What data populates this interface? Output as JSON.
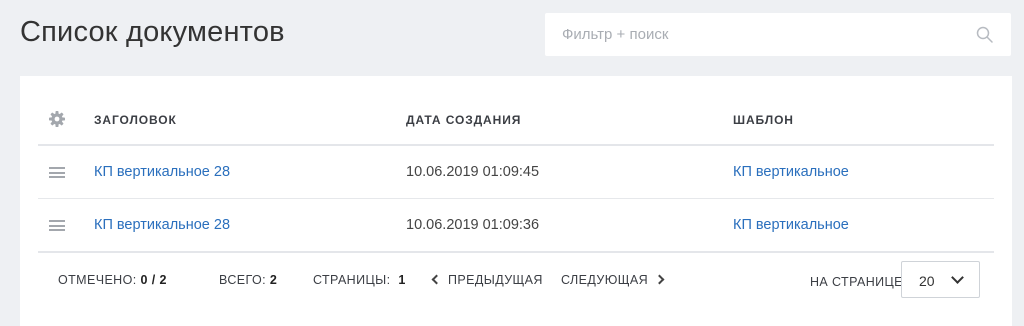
{
  "header": {
    "title": "Список документов",
    "search": {
      "placeholder": "Фильтр + поиск",
      "value": ""
    }
  },
  "table": {
    "columns": [
      "ЗАГОЛОВОК",
      "ДАТА СОЗДАНИЯ",
      "ШАБЛОН"
    ],
    "rows": [
      {
        "title": "КП вертикальное 28",
        "created": "10.06.2019 01:09:45",
        "template": "КП вертикальное"
      },
      {
        "title": "КП вертикальное 28",
        "created": "10.06.2019 01:09:36",
        "template": "КП вертикальное"
      }
    ]
  },
  "footer": {
    "marked_label": "ОТМЕЧЕНО:",
    "marked_value": "0 / 2",
    "total_label": "ВСЕГО:",
    "total_value": "2",
    "pages_label": "СТРАНИЦЫ:",
    "pages_value": "1",
    "prev_label": "ПРЕДЫДУЩАЯ",
    "next_label": "СЛЕДУЮЩАЯ",
    "per_page_label": "НА СТРАНИЦЕ:",
    "per_page_value": "20"
  },
  "colors": {
    "link": "#2a6fbd",
    "background": "#eef0f3"
  },
  "icons": [
    "search-icon",
    "gear-icon",
    "drag-handle-icon",
    "chevron-left-icon",
    "chevron-right-icon",
    "chevron-down-icon"
  ]
}
